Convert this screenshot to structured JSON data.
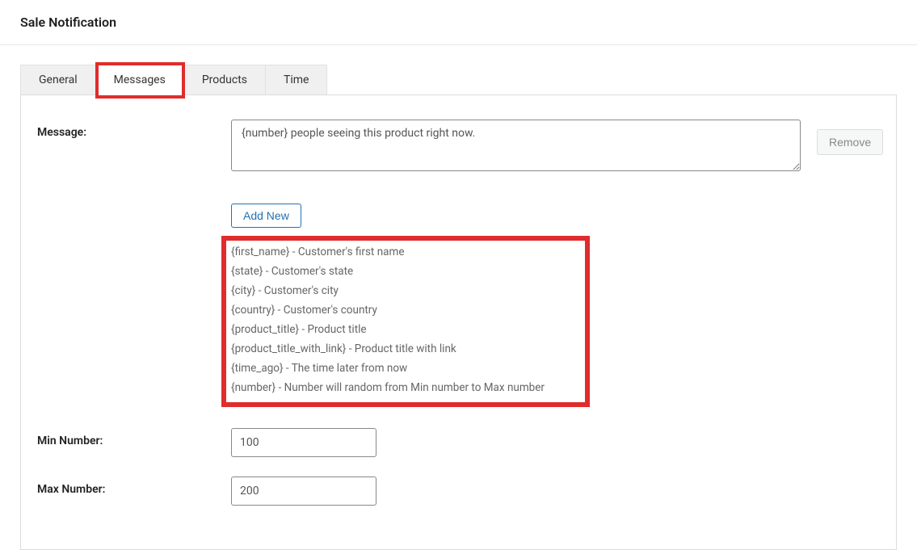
{
  "page": {
    "title": "Sale Notification"
  },
  "tabs": [
    {
      "label": "General",
      "active": false
    },
    {
      "label": "Messages",
      "active": true
    },
    {
      "label": "Products",
      "active": false
    },
    {
      "label": "Time",
      "active": false
    }
  ],
  "form": {
    "message_label": "Message:",
    "message_value": "{number} people seeing this product right now.",
    "remove_label": "Remove",
    "add_new_label": "Add New",
    "min_number_label": "Min Number:",
    "min_number_value": "100",
    "max_number_label": "Max Number:",
    "max_number_value": "200"
  },
  "placeholders": [
    "{first_name} - Customer's first name",
    "{state} - Customer's state",
    "{city} - Customer's city",
    "{country} - Customer's country",
    "{product_title} - Product title",
    "{product_title_with_link} - Product title with link",
    "{time_ago} - The time later from now",
    "{number} - Number will random from Min number to Max number"
  ]
}
